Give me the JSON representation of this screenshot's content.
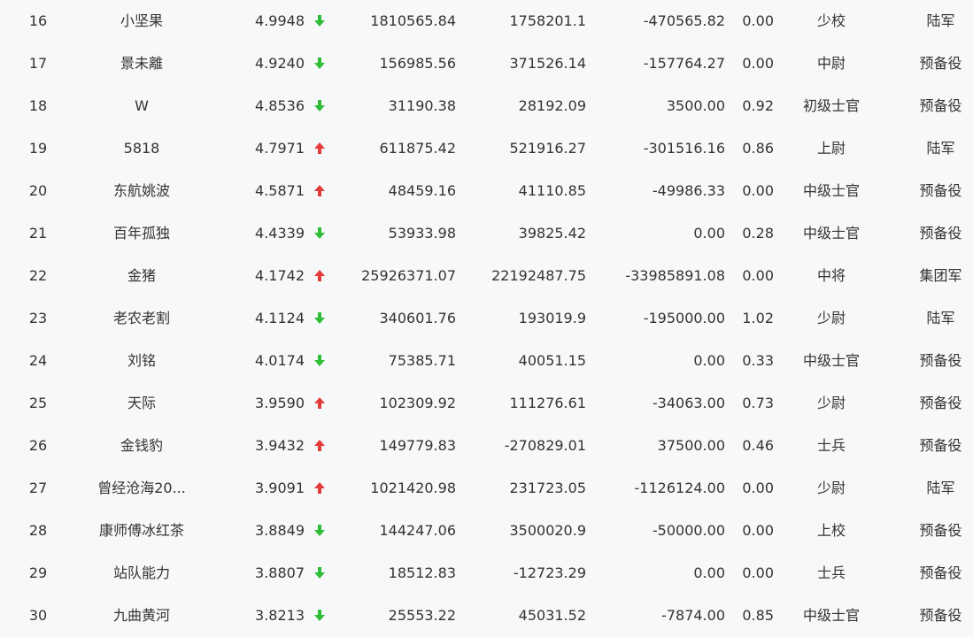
{
  "colors": {
    "up": "#e23c39",
    "down": "#2ebd36",
    "text": "#333333",
    "background": "#f7f8fa"
  },
  "rows": [
    {
      "rank": "16",
      "name": "小坚果",
      "score": "4.9948",
      "trend": "down",
      "v1": "1810565.84",
      "v2": "1758201.1",
      "v3": "-470565.82",
      "ratio": "0.00",
      "title": "少校",
      "unit": "陆军"
    },
    {
      "rank": "17",
      "name": "景未離",
      "score": "4.9240",
      "trend": "down",
      "v1": "156985.56",
      "v2": "371526.14",
      "v3": "-157764.27",
      "ratio": "0.00",
      "title": "中尉",
      "unit": "预备役"
    },
    {
      "rank": "18",
      "name": "W",
      "score": "4.8536",
      "trend": "down",
      "v1": "31190.38",
      "v2": "28192.09",
      "v3": "3500.00",
      "ratio": "0.92",
      "title": "初级士官",
      "unit": "预备役"
    },
    {
      "rank": "19",
      "name": "5818",
      "score": "4.7971",
      "trend": "up",
      "v1": "611875.42",
      "v2": "521916.27",
      "v3": "-301516.16",
      "ratio": "0.86",
      "title": "上尉",
      "unit": "陆军"
    },
    {
      "rank": "20",
      "name": "东航姚波",
      "score": "4.5871",
      "trend": "up",
      "v1": "48459.16",
      "v2": "41110.85",
      "v3": "-49986.33",
      "ratio": "0.00",
      "title": "中级士官",
      "unit": "预备役"
    },
    {
      "rank": "21",
      "name": "百年孤独",
      "score": "4.4339",
      "trend": "down",
      "v1": "53933.98",
      "v2": "39825.42",
      "v3": "0.00",
      "ratio": "0.28",
      "title": "中级士官",
      "unit": "预备役"
    },
    {
      "rank": "22",
      "name": "金猪",
      "score": "4.1742",
      "trend": "up",
      "v1": "25926371.07",
      "v2": "22192487.75",
      "v3": "-33985891.08",
      "ratio": "0.00",
      "title": "中将",
      "unit": "集团军"
    },
    {
      "rank": "23",
      "name": "老农老割",
      "score": "4.1124",
      "trend": "down",
      "v1": "340601.76",
      "v2": "193019.9",
      "v3": "-195000.00",
      "ratio": "1.02",
      "title": "少尉",
      "unit": "陆军"
    },
    {
      "rank": "24",
      "name": "刘铭",
      "score": "4.0174",
      "trend": "down",
      "v1": "75385.71",
      "v2": "40051.15",
      "v3": "0.00",
      "ratio": "0.33",
      "title": "中级士官",
      "unit": "预备役"
    },
    {
      "rank": "25",
      "name": "天际",
      "score": "3.9590",
      "trend": "up",
      "v1": "102309.92",
      "v2": "111276.61",
      "v3": "-34063.00",
      "ratio": "0.73",
      "title": "少尉",
      "unit": "预备役"
    },
    {
      "rank": "26",
      "name": "金钱豹",
      "score": "3.9432",
      "trend": "up",
      "v1": "149779.83",
      "v2": "-270829.01",
      "v3": "37500.00",
      "ratio": "0.46",
      "title": "士兵",
      "unit": "预备役"
    },
    {
      "rank": "27",
      "name": "曾经沧海20...",
      "score": "3.9091",
      "trend": "up",
      "v1": "1021420.98",
      "v2": "231723.05",
      "v3": "-1126124.00",
      "ratio": "0.00",
      "title": "少尉",
      "unit": "陆军"
    },
    {
      "rank": "28",
      "name": "康师傅冰红茶",
      "score": "3.8849",
      "trend": "down",
      "v1": "144247.06",
      "v2": "3500020.9",
      "v3": "-50000.00",
      "ratio": "0.00",
      "title": "上校",
      "unit": "预备役"
    },
    {
      "rank": "29",
      "name": "站队能力",
      "score": "3.8807",
      "trend": "down",
      "v1": "18512.83",
      "v2": "-12723.29",
      "v3": "0.00",
      "ratio": "0.00",
      "title": "士兵",
      "unit": "预备役"
    },
    {
      "rank": "30",
      "name": "九曲黄河",
      "score": "3.8213",
      "trend": "down",
      "v1": "25553.22",
      "v2": "45031.52",
      "v3": "-7874.00",
      "ratio": "0.85",
      "title": "中级士官",
      "unit": "预备役"
    }
  ]
}
